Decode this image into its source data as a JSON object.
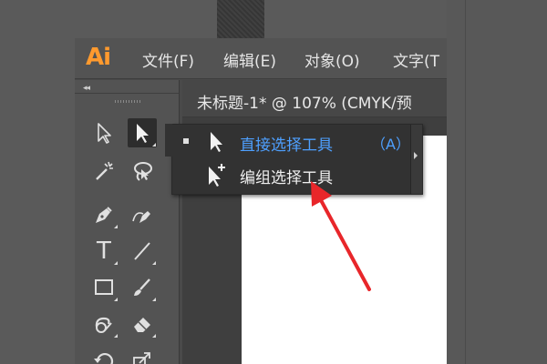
{
  "app": {
    "logo": "Ai",
    "logo_color": "#ff9a2e",
    "menu": [
      "文件(F)",
      "编辑(E)",
      "对象(O)",
      "文字(T"
    ]
  },
  "toolbar": {
    "collapse_glyph": "◂◂",
    "tools": [
      {
        "name": "selection-tool",
        "icon": "arrow-outline-icon"
      },
      {
        "name": "direct-selection-tool",
        "icon": "arrow-solid-icon",
        "active": true
      },
      {
        "name": "magic-wand-tool",
        "icon": "magic-wand-icon"
      },
      {
        "name": "lasso-tool",
        "icon": "lasso-icon"
      },
      {
        "name": "pen-tool",
        "icon": "pen-icon"
      },
      {
        "name": "curvature-tool",
        "icon": "curvature-pen-icon"
      },
      {
        "name": "type-tool",
        "icon": "type-icon",
        "glyph": "T"
      },
      {
        "name": "line-segment-tool",
        "icon": "line-icon"
      },
      {
        "name": "rectangle-tool",
        "icon": "rectangle-icon"
      },
      {
        "name": "paintbrush-tool",
        "icon": "paintbrush-icon"
      },
      {
        "name": "shaper-tool",
        "icon": "shaper-icon"
      },
      {
        "name": "eraser-tool",
        "icon": "eraser-icon"
      },
      {
        "name": "rotate-tool",
        "icon": "rotate-icon"
      },
      {
        "name": "scale-tool",
        "icon": "scale-icon"
      }
    ]
  },
  "document": {
    "tab_title": "未标题-1* @ 107% (CMYK/预"
  },
  "flyout": {
    "items": [
      {
        "label": "直接选择工具",
        "shortcut": "（A）",
        "selected": true
      },
      {
        "label": "编组选择工具",
        "shortcut": "",
        "selected": false
      }
    ],
    "accent_color": "#4ea0ff"
  },
  "annotation": {
    "arrow_color": "#e8262a"
  }
}
